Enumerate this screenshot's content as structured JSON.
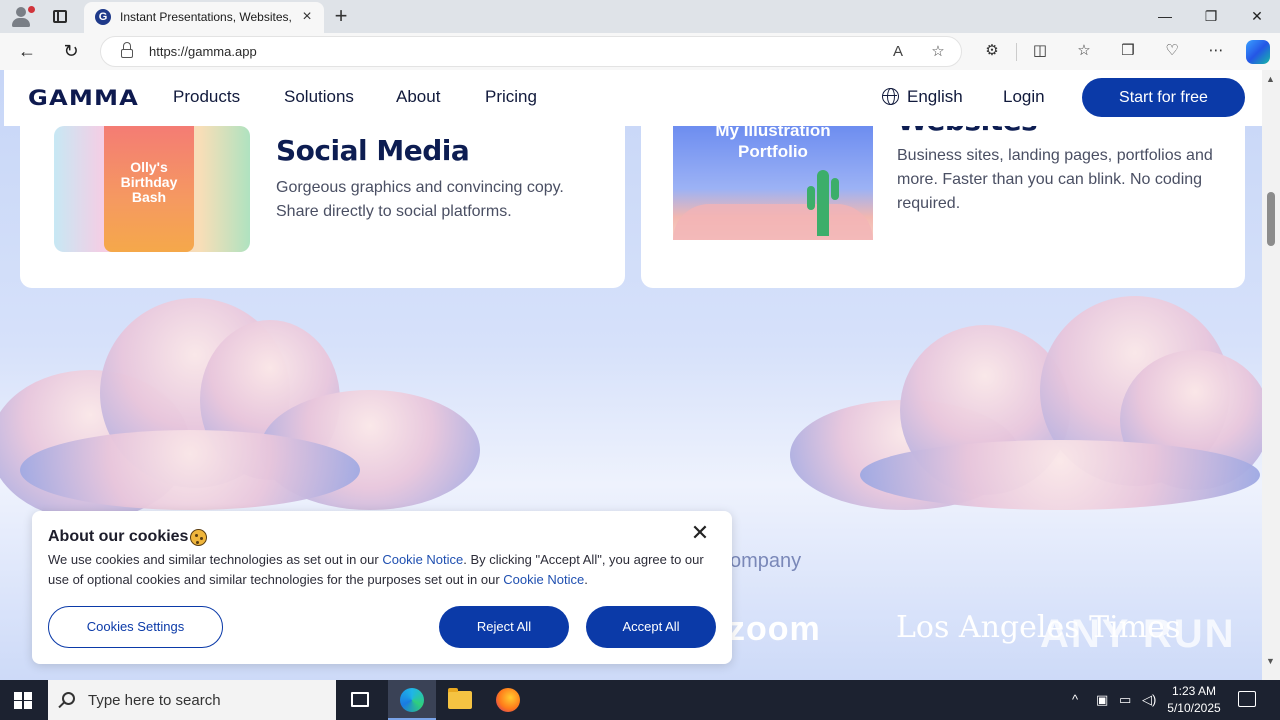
{
  "browser": {
    "tab_title": "Instant Presentations, Websites, a",
    "tab_favicon": "G",
    "url": "https://gamma.app",
    "new_tab_icon": "+",
    "close_icon": "×"
  },
  "site": {
    "logo": "GAMMA",
    "nav": [
      "Products",
      "Solutions",
      "About",
      "Pricing"
    ],
    "language": "English",
    "login": "Login",
    "cta": "Start for free"
  },
  "cards": [
    {
      "title": "Social Media",
      "text": "Gorgeous graphics and convincing copy. Share directly to social platforms.",
      "image_text": "Olly's\nBirthday\nBash"
    },
    {
      "title": "Websites",
      "text": "Business sites, landing pages, portfolios and more. Faster than you can blink. No coding required.",
      "image_text": "My Illustration\nPortfolio"
    }
  ],
  "trust": {
    "text": "ompany",
    "logos": [
      "zoom",
      "Los Angeles Times"
    ]
  },
  "cookie": {
    "title": "About our cookies",
    "text_1": "We use cookies and similar technologies as set out in our ",
    "link_1": "Cookie Notice",
    "text_2": ". By clicking \"Accept All\", you agree to our use of optional cookies and similar technologies for the purposes set out in our ",
    "link_2": "Cookie Notice",
    "text_3": ".",
    "settings_label": "Cookies Settings",
    "reject_label": "Reject All",
    "accept_label": "Accept All"
  },
  "watermark": "ANY RUN",
  "taskbar": {
    "search_placeholder": "Type here to search",
    "time": "1:23 AM",
    "date": "5/10/2025"
  },
  "colors": {
    "brand": "#0b3aa8",
    "heading": "#0d1d52"
  }
}
